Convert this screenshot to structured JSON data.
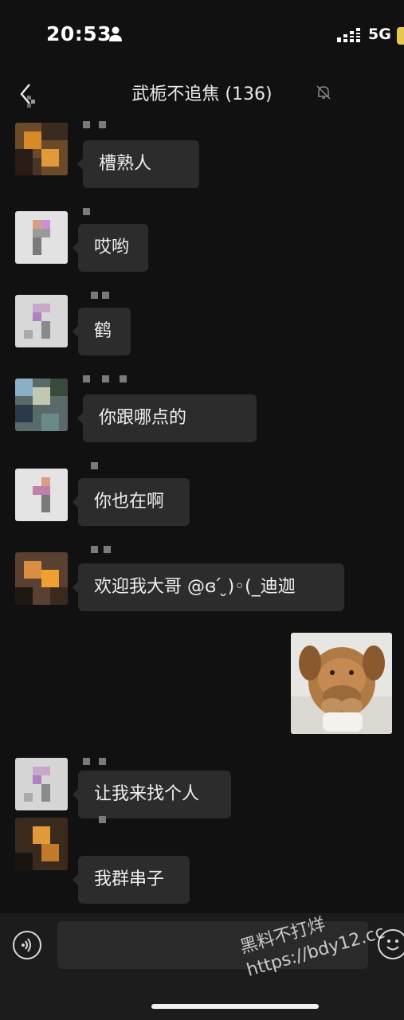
{
  "status_bar": {
    "time": "20:53",
    "network": "5G"
  },
  "header": {
    "title": "武栀不追焦 (136)"
  },
  "messages": [
    {
      "text": "槽熟人"
    },
    {
      "text": "哎哟"
    },
    {
      "text": "鹤"
    },
    {
      "text": "你跟哪点的"
    },
    {
      "text": "你也在啊"
    },
    {
      "text": "欢迎我大哥 @ɞ ́ ̮)◦(_迪迦"
    },
    {
      "text": "让我来找个人"
    },
    {
      "text": "我群串子"
    }
  ],
  "image_message": {
    "description_icon": "dog-sticker"
  },
  "input": {
    "placeholder": ""
  },
  "watermark": {
    "line1": "黑料不打烊",
    "line2": "https://bdy12.cc"
  },
  "colors": {
    "background": "#111111",
    "bubble": "#2c2c2c",
    "text": "#f0f0f0"
  }
}
